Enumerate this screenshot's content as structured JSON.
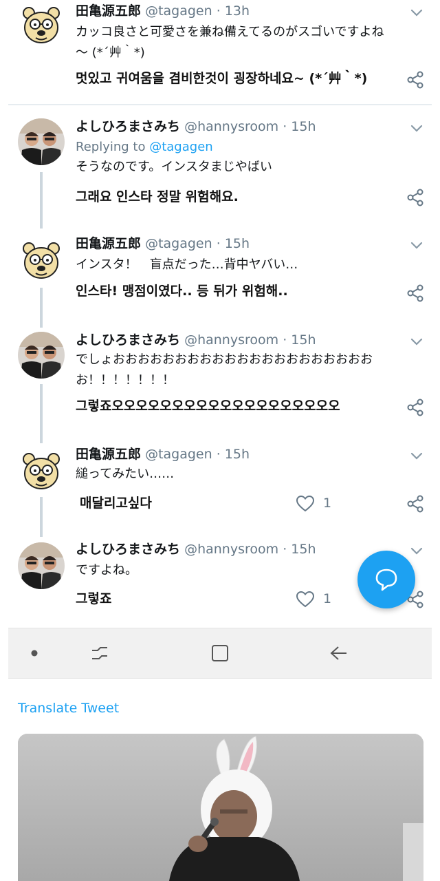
{
  "tweets": [
    {
      "author": "田亀源五郎",
      "handle": "@tagagen",
      "dot": "·",
      "time": "13h",
      "avatar": "bear-avatar",
      "reply_prefix": "",
      "reply_handle": "",
      "jp_lines": [
        "カッコ良さと可愛さを兼ね備えてるのがスゴいですよね",
        "～ (*´艸｀*)"
      ],
      "ko": "멋있고 귀여움을 겸비한것이 굉장하네요~ (*´艸｀*)",
      "likes": ""
    },
    {
      "author": "よしひろまさみち",
      "handle": "@hannysroom",
      "dot": "·",
      "time": "15h",
      "avatar": "photo-avatar",
      "reply_prefix": "Replying to",
      "reply_handle": "@tagagen",
      "jp_lines": [
        "そうなのです。インスタまじやばい"
      ],
      "ko": "그래요 인스타 정말 위험해요.",
      "likes": ""
    },
    {
      "author": "田亀源五郎",
      "handle": "@tagagen",
      "dot": "·",
      "time": "15h",
      "avatar": "bear-avatar",
      "reply_prefix": "",
      "reply_handle": "",
      "jp_lines": [
        "インスタ！　盲点だった…背中ヤバい…"
      ],
      "ko": "인스타! 맹점이였다.. 등 뒤가 위험해..",
      "likes": ""
    },
    {
      "author": "よしひろまさみち",
      "handle": "@hannysroom",
      "dot": "·",
      "time": "15h",
      "avatar": "photo-avatar",
      "reply_prefix": "",
      "reply_handle": "",
      "jp_lines": [
        "でしょおおおおおおおおおおおおおおおおおおおおお",
        "お！！！！！！！"
      ],
      "ko": "그렇죠오오오오오오오오오오오오오오오오오오오",
      "likes": ""
    },
    {
      "author": "田亀源五郎",
      "handle": "@tagagen",
      "dot": "·",
      "time": "15h",
      "avatar": "bear-avatar",
      "reply_prefix": "",
      "reply_handle": "",
      "jp_lines": [
        "縋ってみたい……"
      ],
      "ko": "매달리고싶다",
      "likes": "1"
    },
    {
      "author": "よしひろまさみち",
      "handle": "@hannysroom",
      "dot": "·",
      "time": "15h",
      "avatar": "photo-avatar",
      "reply_prefix": "",
      "reply_handle": "",
      "jp_lines": [
        "ですよね。"
      ],
      "ko": "그렇죠",
      "likes": "1"
    }
  ],
  "translate_label": "Translate Tweet",
  "colors": {
    "accent": "#1da1f2",
    "secondary_text": "#657786",
    "thread_line": "#ccd6dd",
    "nav_background": "#f1f1f1"
  },
  "icons": {
    "menu": "chevron-down-icon",
    "share": "share-icon",
    "like": "heart-icon",
    "compose": "compose-reply-icon",
    "nav": [
      "nav-dot-icon",
      "recent-apps-icon",
      "home-square-icon",
      "back-arrow-icon"
    ]
  }
}
